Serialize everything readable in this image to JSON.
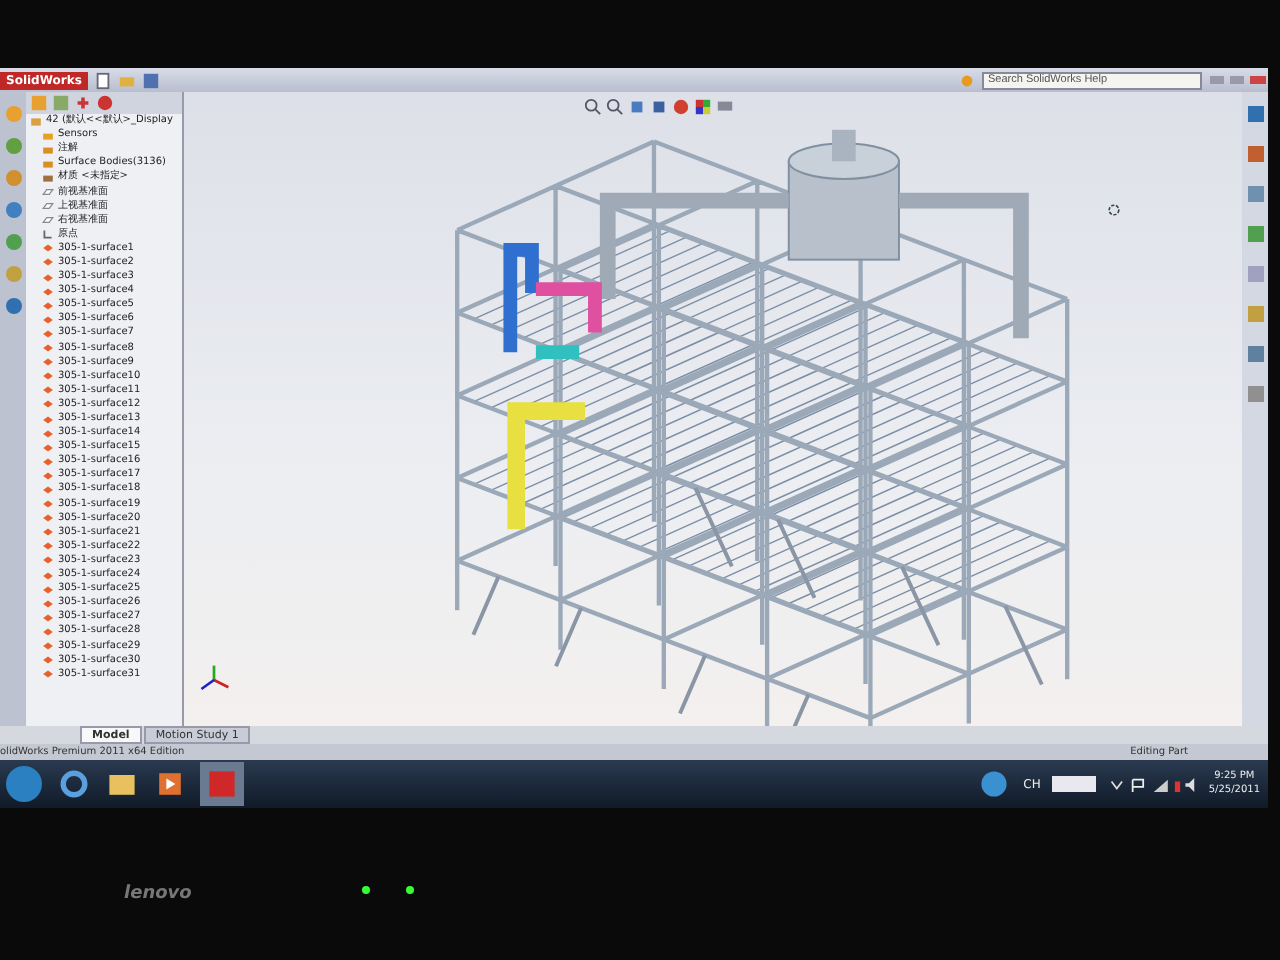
{
  "window": {
    "logo": "SolidWorks",
    "search": {
      "placeholder": "Search SolidWorks Help"
    }
  },
  "tree": {
    "root": {
      "label": "42 (默认<<默认>_Display",
      "children": [
        {
          "kind": "sensor",
          "label": "Sensors"
        },
        {
          "kind": "annotation",
          "label": "注解"
        },
        {
          "kind": "bodies",
          "label": "Surface Bodies(3136)"
        },
        {
          "kind": "material",
          "label": "材质 <未指定>"
        },
        {
          "kind": "plane",
          "label": "前视基准面"
        },
        {
          "kind": "plane",
          "label": "上视基准面"
        },
        {
          "kind": "plane",
          "label": "右视基准面"
        },
        {
          "kind": "origin",
          "label": "原点"
        },
        {
          "kind": "surface",
          "label": "305-1-surface1"
        },
        {
          "kind": "surface",
          "label": "305-1-surface2"
        },
        {
          "kind": "surface",
          "label": "305-1-surface3"
        },
        {
          "kind": "surface",
          "label": "305-1-surface4"
        },
        {
          "kind": "surface",
          "label": "305-1-surface5"
        },
        {
          "kind": "surface",
          "label": "305-1-surface6"
        },
        {
          "kind": "surface",
          "label": "305-1-surface7"
        },
        {
          "kind": "surface",
          "label": "305-1-surface8"
        },
        {
          "kind": "surface",
          "label": "305-1-surface9"
        },
        {
          "kind": "surface",
          "label": "305-1-surface10"
        },
        {
          "kind": "surface",
          "label": "305-1-surface11"
        },
        {
          "kind": "surface",
          "label": "305-1-surface12"
        },
        {
          "kind": "surface",
          "label": "305-1-surface13"
        },
        {
          "kind": "surface",
          "label": "305-1-surface14"
        },
        {
          "kind": "surface",
          "label": "305-1-surface15"
        },
        {
          "kind": "surface",
          "label": "305-1-surface16"
        },
        {
          "kind": "surface",
          "label": "305-1-surface17"
        },
        {
          "kind": "surface",
          "label": "305-1-surface18"
        },
        {
          "kind": "surface",
          "label": "305-1-surface19"
        },
        {
          "kind": "surface",
          "label": "305-1-surface20"
        },
        {
          "kind": "surface",
          "label": "305-1-surface21"
        },
        {
          "kind": "surface",
          "label": "305-1-surface22"
        },
        {
          "kind": "surface",
          "label": "305-1-surface23"
        },
        {
          "kind": "surface",
          "label": "305-1-surface24"
        },
        {
          "kind": "surface",
          "label": "305-1-surface25"
        },
        {
          "kind": "surface",
          "label": "305-1-surface26"
        },
        {
          "kind": "surface",
          "label": "305-1-surface27"
        },
        {
          "kind": "surface",
          "label": "305-1-surface28"
        },
        {
          "kind": "surface",
          "label": "305-1-surface29"
        },
        {
          "kind": "surface",
          "label": "305-1-surface30"
        },
        {
          "kind": "surface",
          "label": "305-1-surface31"
        }
      ]
    }
  },
  "tabs": [
    {
      "label": "Model",
      "selected": true
    },
    {
      "label": "Motion Study 1",
      "selected": false
    }
  ],
  "status_bar": {
    "product": "olidWorks Premium 2011 x64 Edition",
    "mode": "Editing Part"
  },
  "taskbar": {
    "language": "CH",
    "time": "9:25 PM",
    "date": "5/25/2011"
  },
  "bezel": {
    "brand": "lenovo"
  }
}
